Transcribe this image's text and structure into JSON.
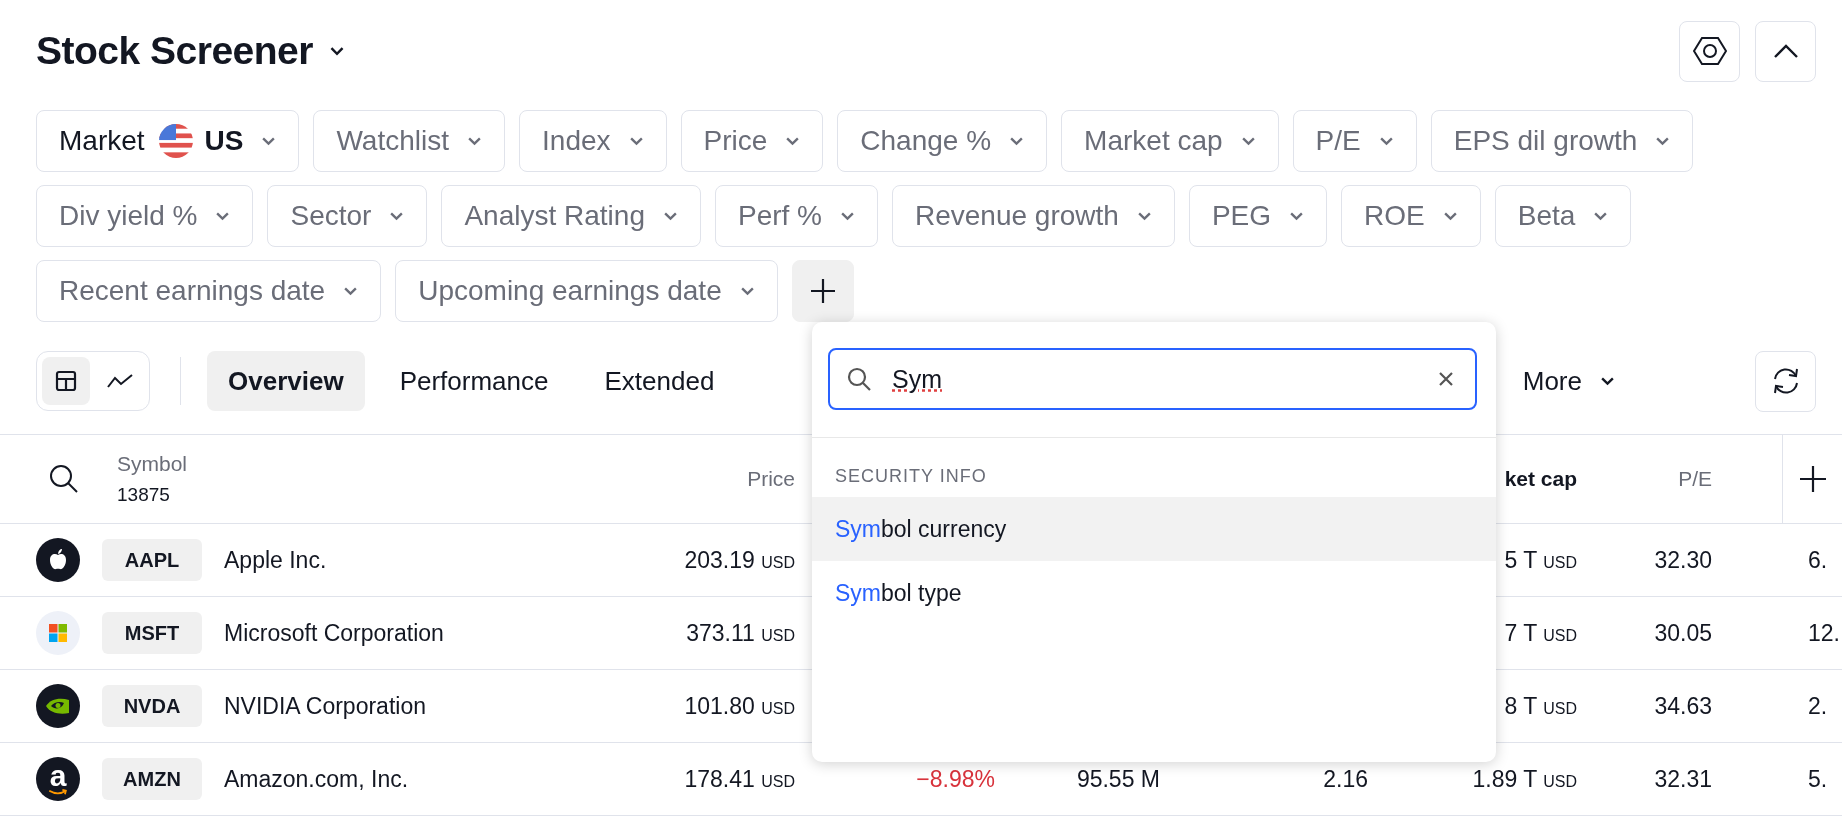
{
  "title": "Stock Screener",
  "filters": [
    {
      "label": "Market",
      "value": "US",
      "active": true
    },
    {
      "label": "Watchlist",
      "active": false
    },
    {
      "label": "Index",
      "active": false
    },
    {
      "label": "Price",
      "active": false
    },
    {
      "label": "Change %",
      "active": false
    },
    {
      "label": "Market cap",
      "active": false
    },
    {
      "label": "P/E",
      "active": false
    },
    {
      "label": "EPS dil growth",
      "active": false
    },
    {
      "label": "Div yield %",
      "active": false
    },
    {
      "label": "Sector",
      "active": false
    },
    {
      "label": "Analyst Rating",
      "active": false
    },
    {
      "label": "Perf %",
      "active": false
    },
    {
      "label": "Revenue growth",
      "active": false
    },
    {
      "label": "PEG",
      "active": false
    },
    {
      "label": "ROE",
      "active": false
    },
    {
      "label": "Beta",
      "active": false
    },
    {
      "label": "Recent earnings date",
      "active": false
    },
    {
      "label": "Upcoming earnings date",
      "active": false
    }
  ],
  "add_filter": {
    "open": true
  },
  "toolbar": {
    "views": [
      {
        "kind": "table",
        "selected": true
      },
      {
        "kind": "chart",
        "selected": false
      }
    ],
    "tabs": [
      {
        "label": "Overview",
        "selected": true
      },
      {
        "label": "Performance",
        "selected": false
      },
      {
        "label": "Extended",
        "selected": false
      }
    ],
    "more": "More"
  },
  "table": {
    "symbol_header": "Symbol",
    "count": "13875",
    "columns": {
      "price": {
        "label": "Price",
        "sorted": false
      },
      "market_cap": {
        "label": "ket cap",
        "sorted": true
      },
      "pe": {
        "label": "P/E",
        "sorted": false
      }
    },
    "rows": [
      {
        "logo": {
          "kind": "apple"
        },
        "symbol": "AAPL",
        "name": "Apple Inc.",
        "price": "203.19",
        "price_unit": "USD",
        "market_cap": "5 T",
        "market_cap_unit": "USD",
        "pe": "32.30",
        "column_9": "6."
      },
      {
        "logo": {
          "kind": "squares"
        },
        "symbol": "MSFT",
        "name": "Microsoft Corporation",
        "price": "373.11",
        "price_unit": "USD",
        "market_cap": "7 T",
        "market_cap_unit": "USD",
        "pe": "30.05",
        "column_9": "12."
      },
      {
        "logo": {
          "kind": "eye"
        },
        "symbol": "NVDA",
        "name": "NVIDIA Corporation",
        "price": "101.80",
        "price_unit": "USD",
        "market_cap": "8 T",
        "market_cap_unit": "USD",
        "pe": "34.63",
        "column_9": "2."
      },
      {
        "logo": {
          "kind": "letter",
          "letter": "a"
        },
        "symbol": "AMZN",
        "name": "Amazon.com, Inc.",
        "price": "178.41",
        "price_unit": "USD",
        "change": "−8.98%",
        "change_negative": true,
        "volume": "95.55 M",
        "column_6": "2.16",
        "market_cap": "1.89 T",
        "market_cap_unit": "USD",
        "pe": "32.31",
        "column_9": "5."
      }
    ]
  },
  "popup": {
    "query": "Sym",
    "misspelled": true,
    "section": "SECURITY INFO",
    "items": [
      {
        "match": "Sym",
        "rest": "bol currency",
        "selected": true
      },
      {
        "match": "Sym",
        "rest": "bol type",
        "selected": false
      }
    ]
  }
}
